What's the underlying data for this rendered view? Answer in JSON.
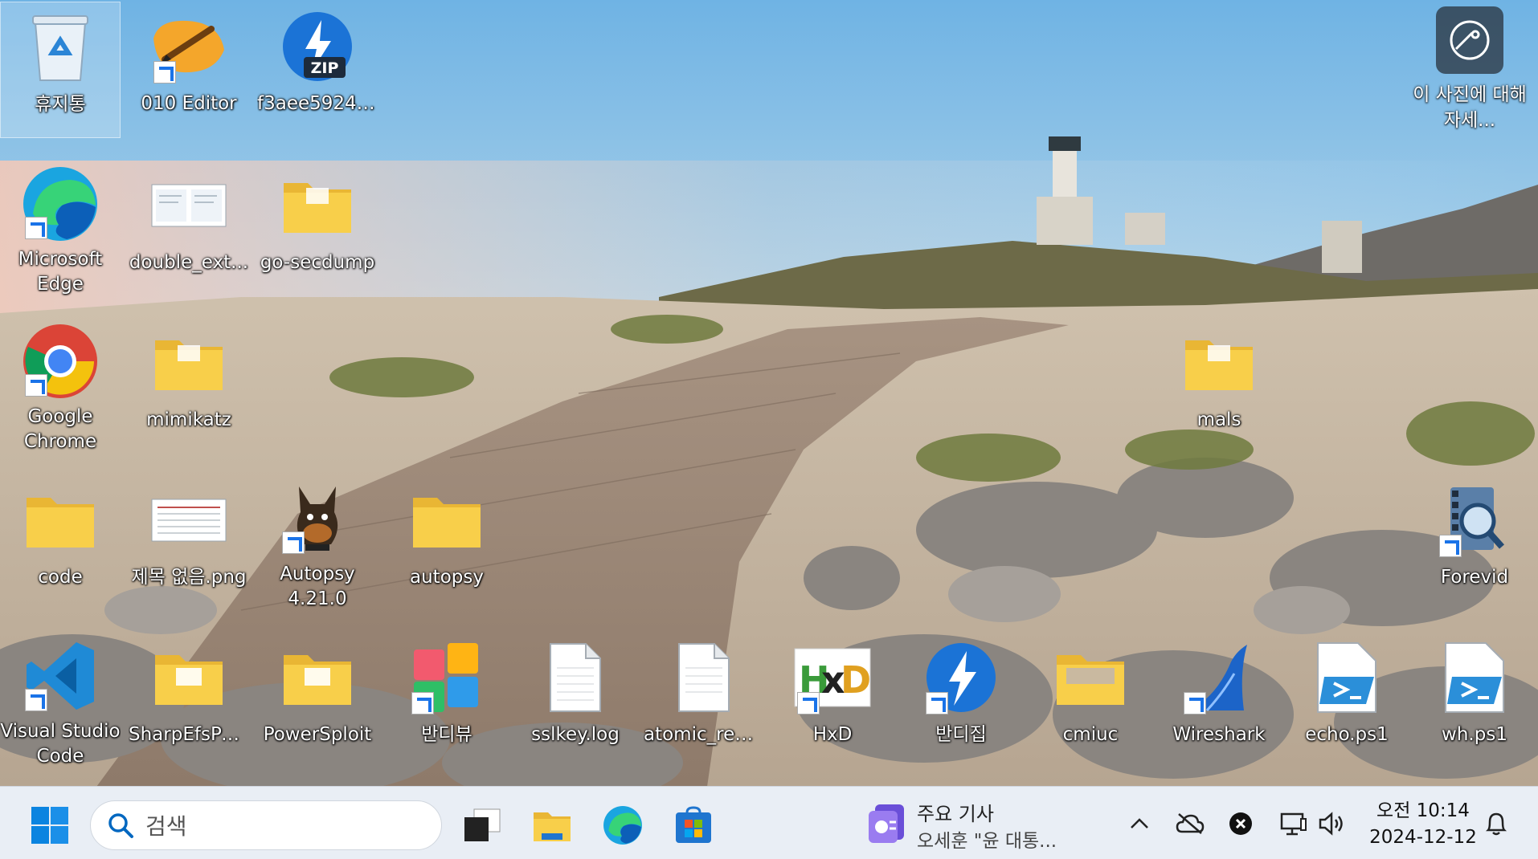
{
  "desktop": {
    "icons": [
      {
        "label": "휴지통",
        "icon": "recycle-bin-icon"
      },
      {
        "label": "010 Editor",
        "icon": "editor-icon"
      },
      {
        "label": "f3aee592427...",
        "icon": "zip-icon"
      },
      {
        "label": "Microsoft Edge",
        "icon": "edge-icon"
      },
      {
        "label": "double_ext...",
        "icon": "image-file-icon"
      },
      {
        "label": "go-secdump",
        "icon": "folder-icon"
      },
      {
        "label": "Google Chrome",
        "icon": "chrome-icon"
      },
      {
        "label": "mimikatz",
        "icon": "folder-icon"
      },
      {
        "label": "mals",
        "icon": "folder-icon"
      },
      {
        "label": "code",
        "icon": "folder-icon"
      },
      {
        "label": "제목 없음.png",
        "icon": "image-file-icon"
      },
      {
        "label": "Autopsy 4.21.0",
        "icon": "autopsy-icon"
      },
      {
        "label": "autopsy",
        "icon": "folder-icon"
      },
      {
        "label": "Forevid",
        "icon": "forevid-icon"
      },
      {
        "label": "Visual Studio Code",
        "icon": "vscode-icon"
      },
      {
        "label": "SharpEfsPot...",
        "icon": "folder-icon"
      },
      {
        "label": "PowerSploit",
        "icon": "folder-icon"
      },
      {
        "label": "반디뷰",
        "icon": "bandiview-icon"
      },
      {
        "label": "sslkey.log",
        "icon": "text-file-icon"
      },
      {
        "label": "atomic_redt...",
        "icon": "text-file-icon"
      },
      {
        "label": "HxD",
        "icon": "hxd-icon"
      },
      {
        "label": "반디집",
        "icon": "bandizip-icon"
      },
      {
        "label": "cmiuc",
        "icon": "folder-icon"
      },
      {
        "label": "Wireshark",
        "icon": "wireshark-icon"
      },
      {
        "label": "echo.ps1",
        "icon": "powershell-file-icon"
      },
      {
        "label": "wh.ps1",
        "icon": "powershell-file-icon"
      }
    ],
    "photo_info": {
      "label": "이 사진에 대해 자세...",
      "icon": "camera-info-icon"
    }
  },
  "taskbar": {
    "start_icon": "windows-start-icon",
    "search_placeholder": "검색",
    "pinned": [
      "task-view-icon",
      "file-explorer-icon",
      "edge-icon",
      "microsoft-store-icon"
    ],
    "news": {
      "title": "주요 기사",
      "headline": "오세훈 \"윤 대통..."
    },
    "tray": [
      "chevron-up-icon",
      "onedrive-offline-icon",
      "close-circle-icon",
      "network-icon",
      "volume-icon"
    ],
    "clock": {
      "time": "오전 10:14",
      "date": "2024-12-12"
    },
    "notification_icon": "bell-icon"
  },
  "colors": {
    "taskbar_bg": "#e9eef5",
    "folder": "#f8cf4a",
    "accent": "#0067c0"
  }
}
